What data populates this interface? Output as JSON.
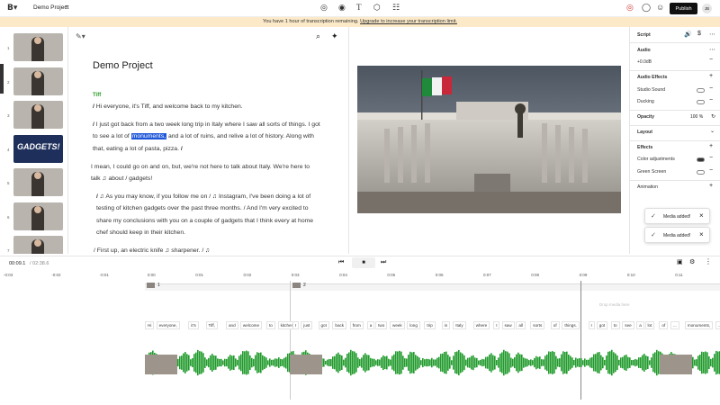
{
  "topbar": {
    "project_name": "Demo Project",
    "publish": "Publish",
    "avatar": "JB"
  },
  "banner": {
    "text": "You have 1 hour of transcription remaining.",
    "link": "Upgrade to increase your transcription limit."
  },
  "slides": [
    {
      "n": "1"
    },
    {
      "n": "2"
    },
    {
      "n": "3"
    },
    {
      "n": "4",
      "title": "GADGETS!"
    },
    {
      "n": "5"
    },
    {
      "n": "6"
    },
    {
      "n": "7"
    }
  ],
  "editor": {
    "title": "Demo Project",
    "speaker": "Tiff",
    "p1": "Hi everyone, it's Tiff, and welcome back to my kitchen.",
    "p2a": "I just got back from a two week long trip in Italy where I saw all sorts of things. I got to see a lot of",
    "p2hl": "monuments,",
    "p2b": "and a lot of ruins, and relive a lot of history. Along with that, eating a lot of pasta, pizza.",
    "p3": "I mean, I could go on and on, but, we're not here to talk about Italy. We're here to talk ♫ about / gadgets!",
    "p4": "♫ As you may know, if you follow me on / ♫ Instagram, I've been doing a lot of testing of kitchen gadgets over the past three months. / And I'm very excited to share my conclusions with you on a couple of gadgets that I think every at home chef should keep in their kitchen.",
    "p5": "/ First up, an electric knife ♫ sharpener. / ♫"
  },
  "right": {
    "script": "Script",
    "audio": "Audio",
    "gain": "+0.0dB",
    "effects_title": "Audio Effects",
    "studio": "Studio Sound",
    "ducking": "Ducking",
    "opacity": "Opacity",
    "opacity_val": "100 %",
    "layout": "Layout",
    "effects": "Effects",
    "color": "Color adjustments",
    "green": "Green Screen",
    "animation": "Animation"
  },
  "toasts": [
    "Media added!",
    "Media added!"
  ],
  "controls": {
    "time": "00:09.1",
    "total": "/ 02:38.6"
  },
  "ruler": [
    "-0:03",
    "-0:02",
    "-0:01",
    "0:00",
    "0:01",
    "0:02",
    "0:03",
    "0:04",
    "0:05",
    "0:06",
    "0:07",
    "0:08",
    "0:09",
    "0:10",
    "0:11"
  ],
  "tracks": {
    "clip1": "1",
    "clip2": "2",
    "hint": "Drop media here"
  },
  "words": [
    "Hi",
    "everyone,",
    "it's",
    "Tiff,",
    "and",
    "welcome",
    "to",
    "kitchen.",
    "I",
    "just",
    "got",
    "back",
    "from",
    "a",
    "two",
    "week",
    "long",
    "trip",
    "in",
    "Italy",
    "where",
    "I",
    "saw",
    "all",
    "sorts",
    "of",
    "things.",
    "I",
    "got",
    "to",
    "see",
    "a",
    "lot",
    "of",
    "...",
    "monuments,",
    "and",
    "a",
    "lot",
    "...",
    "and",
    "..."
  ],
  "colors": {
    "accent": "#1e56d9",
    "wave": "#1f9a2a",
    "banner": "#fbe9c8"
  }
}
